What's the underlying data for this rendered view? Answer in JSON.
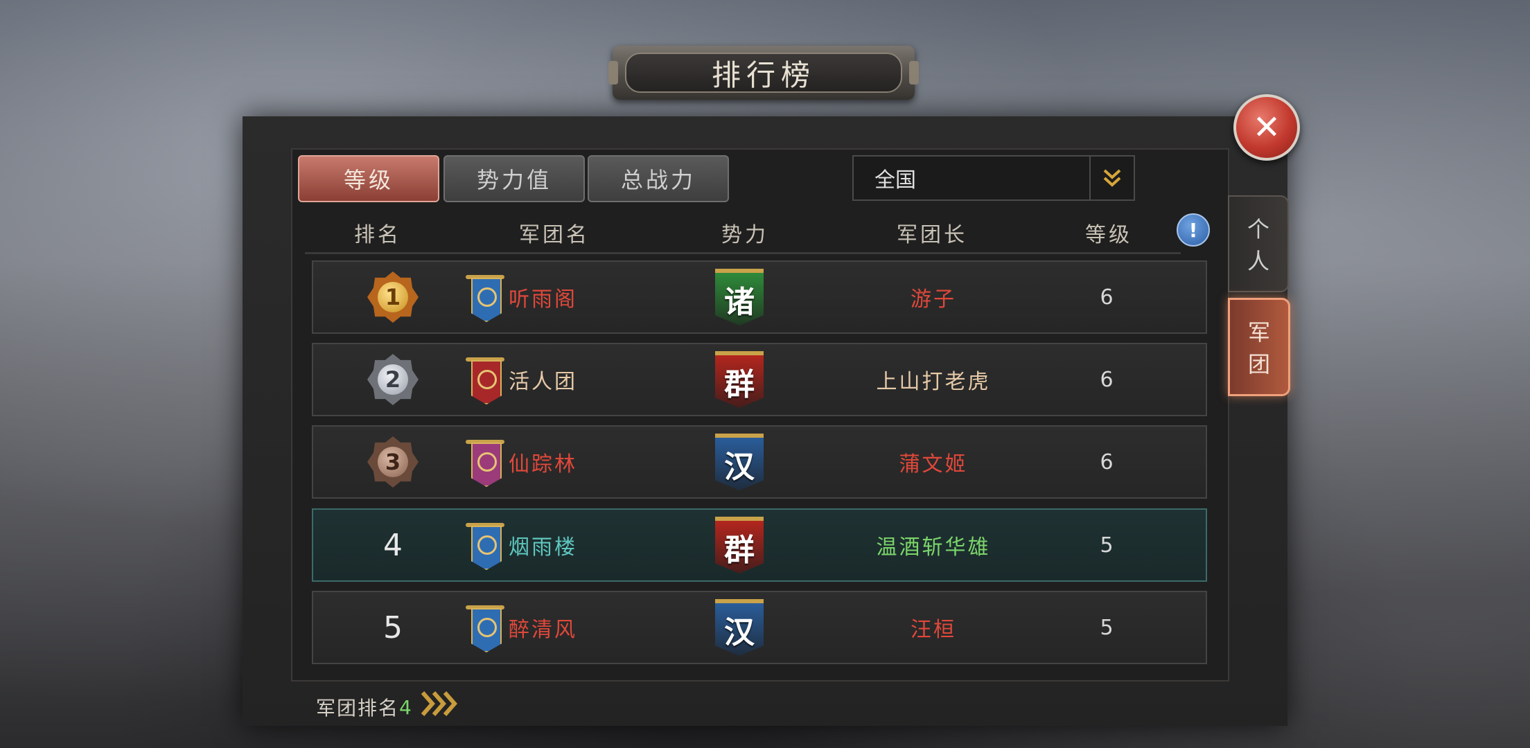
{
  "title": "排行榜",
  "tabs": [
    {
      "label": "等级",
      "active": true
    },
    {
      "label": "势力值",
      "active": false
    },
    {
      "label": "总战力",
      "active": false
    }
  ],
  "region_select": {
    "value": "全国"
  },
  "headers": {
    "rank": "排名",
    "legion": "军团名",
    "faction": "势力",
    "leader": "军团长",
    "level": "等级"
  },
  "info_icon": "!",
  "close_icon": "✕",
  "rows": [
    {
      "rank": "1",
      "medal": "gold",
      "legion": "听雨阁",
      "legion_color": "#e0483a",
      "emblem_color": "#2f6db3",
      "faction": "诸",
      "faction_color": "#2f8a3a",
      "leader": "游子",
      "leader_color": "#e0483a",
      "level": "6",
      "highlight": false
    },
    {
      "rank": "2",
      "medal": "silver",
      "legion": "活人团",
      "legion_color": "#e6c9a8",
      "emblem_color": "#a8282a",
      "faction": "群",
      "faction_color": "#b3261e",
      "leader": "上山打老虎",
      "leader_color": "#e6c9a8",
      "level": "6",
      "highlight": false
    },
    {
      "rank": "3",
      "medal": "bronze",
      "legion": "仙踪林",
      "legion_color": "#e0483a",
      "emblem_color": "#9b3b7a",
      "faction": "汉",
      "faction_color": "#2a5d9a",
      "leader": "蒲文姬",
      "leader_color": "#e0483a",
      "level": "6",
      "highlight": false
    },
    {
      "rank": "4",
      "medal": "",
      "legion": "烟雨楼",
      "legion_color": "#5ec7c0",
      "emblem_color": "#2f6db3",
      "faction": "群",
      "faction_color": "#b3261e",
      "leader": "温酒斩华雄",
      "leader_color": "#7bd66a",
      "level": "5",
      "highlight": true
    },
    {
      "rank": "5",
      "medal": "",
      "legion": "醉清风",
      "legion_color": "#e0483a",
      "emblem_color": "#2f6db3",
      "faction": "汉",
      "faction_color": "#2a5d9a",
      "leader": "汪桓",
      "leader_color": "#e0483a",
      "level": "5",
      "highlight": false
    }
  ],
  "side_tabs": [
    {
      "label_1": "个",
      "label_2": "人",
      "active": false
    },
    {
      "label_1": "军",
      "label_2": "团",
      "active": true
    }
  ],
  "footer": {
    "label": "军团排名",
    "rank": "4",
    "arrow_icon": "chevron-right-icon"
  }
}
